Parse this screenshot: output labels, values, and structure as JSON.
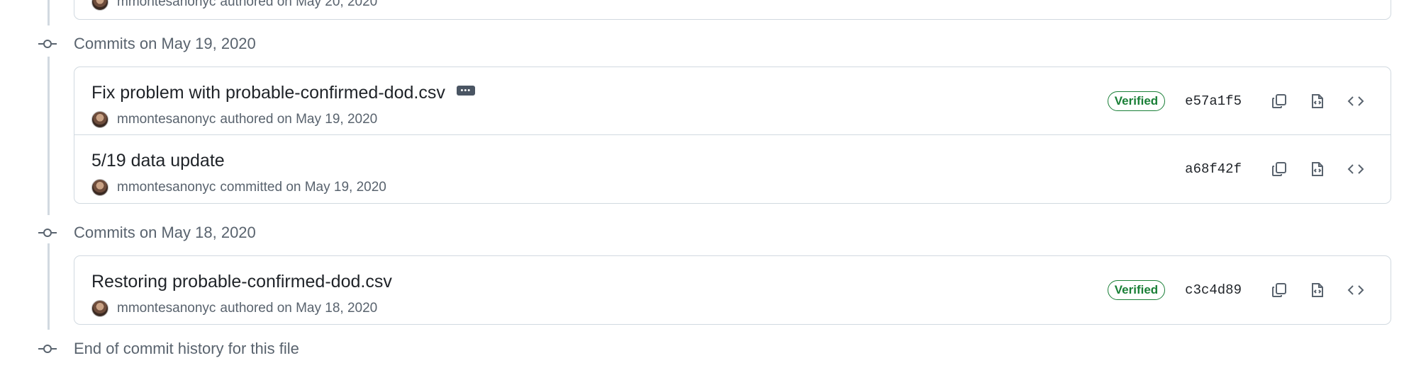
{
  "top_stub": {
    "author": "mmontesanonyc",
    "text": "authored on May 20, 2020"
  },
  "groups": [
    {
      "title": "Commits on May 19, 2020",
      "commits": [
        {
          "message": "Fix problem with probable-confirmed-dod.csv",
          "has_more": true,
          "more_label": "•••",
          "author": "mmontesanonyc",
          "action": "authored on May 19, 2020",
          "verified": "Verified",
          "sha": "e57a1f5"
        },
        {
          "message": "5/19 data update",
          "author": "mmontesanonyc",
          "action": "committed on May 19, 2020",
          "sha": "a68f42f"
        }
      ]
    },
    {
      "title": "Commits on May 18, 2020",
      "commits": [
        {
          "message": "Restoring probable-confirmed-dod.csv",
          "author": "mmontesanonyc",
          "action": "authored on May 18, 2020",
          "verified": "Verified",
          "sha": "c3c4d89"
        }
      ]
    }
  ],
  "end_text": "End of commit history for this file",
  "colors": {
    "verified_green": "#1a7f37",
    "muted_text": "#59636e",
    "border": "#d1d9e0"
  },
  "icons": {
    "commit_node": "git-commit-icon",
    "copy": "copy-icon",
    "browse_files": "file-code-icon",
    "browse_repo": "code-icon"
  }
}
